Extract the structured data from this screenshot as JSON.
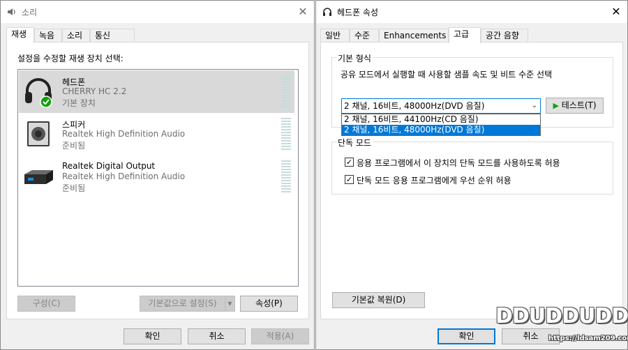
{
  "sound_window": {
    "title": "소리",
    "close_glyph": "✕",
    "tabs": [
      "재생",
      "녹음",
      "소리",
      "통신"
    ],
    "instruction": "설정을 수정할 재생 장치 선택:",
    "devices": [
      {
        "name": "헤드폰",
        "desc": "CHERRY HC 2.2",
        "status": "기본 장치",
        "icon": "headphones-icon",
        "default_check": true,
        "selected": true
      },
      {
        "name": "스피커",
        "desc": "Realtek High Definition Audio",
        "status": "준비됨",
        "icon": "speaker-icon",
        "selected": false
      },
      {
        "name": "Realtek Digital Output",
        "desc": "Realtek High Definition Audio",
        "status": "준비됨",
        "icon": "digital-output-icon",
        "selected": false
      }
    ],
    "buttons": {
      "configure": "구성(C)",
      "set_default": "기본값으로 설정(S)",
      "properties": "속성(P)",
      "ok": "확인",
      "cancel": "취소",
      "apply": "적용(A)"
    }
  },
  "properties_window": {
    "title": "헤드폰 속성",
    "close_glyph": "✕",
    "tabs": [
      "일반",
      "수준",
      "Enhancements",
      "고급",
      "공간 음향"
    ],
    "active_tab": "고급",
    "default_format": {
      "group_title": "기본 형식",
      "description": "공유 모드에서 실행할 때 사용할 샘플 속도 및 비트 수준 선택",
      "selected": "2 채널, 16비트, 48000Hz(DVD 음질)",
      "options": [
        "2 채널, 16비트, 44100Hz(CD 음질)",
        "2 채널, 16비트, 48000Hz(DVD 음질)"
      ],
      "test_button": "테스트(T)"
    },
    "exclusive_mode": {
      "group_title": "단독 모드",
      "allow_exclusive": {
        "label": "응용 프로그램에서 이 장치의 단독 모드를 사용하도록 허용",
        "checked": true
      },
      "give_priority": {
        "label": "단독 모드 응용 프로그램에게 우선 순위 허용",
        "checked": true
      }
    },
    "buttons": {
      "restore_defaults": "기본값 복원(D)",
      "ok": "확인",
      "cancel": "취소"
    }
  },
  "watermark": {
    "text": "DDUDDUDDU",
    "url": "https://ldsam209.com"
  },
  "colors": {
    "accent": "#0078d7",
    "check_green": "#13a10e"
  }
}
